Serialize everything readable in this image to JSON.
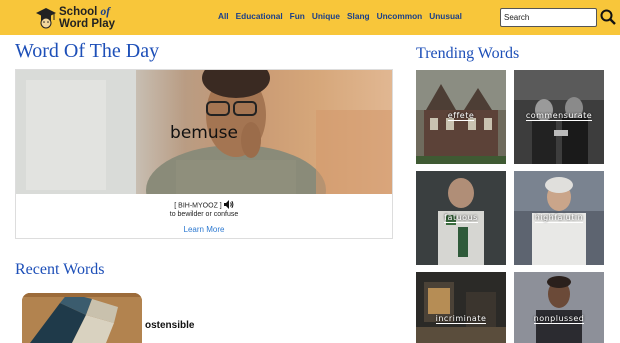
{
  "header": {
    "logo_line1": "School",
    "logo_of": "of",
    "logo_line2": "Word Play",
    "nav": [
      "All",
      "Educational",
      "Fun",
      "Unique",
      "Slang",
      "Uncommon",
      "Unusual"
    ],
    "search_placeholder": "Search"
  },
  "wotd": {
    "title": "Word Of The Day",
    "word": "bemuse",
    "pronunciation": "[ BIH-MYOOZ ]",
    "definition": "to bewilder or confuse",
    "learn_more": "Learn More"
  },
  "recent": {
    "title": "Recent Words",
    "items": [
      {
        "word": "ostensible"
      }
    ]
  },
  "trending": {
    "title": "Trending Words",
    "items": [
      {
        "word": "effete"
      },
      {
        "word": "commensurate"
      },
      {
        "word": "fatuous"
      },
      {
        "word": "highfalutin"
      },
      {
        "word": "incriminate"
      },
      {
        "word": "nonplussed"
      }
    ]
  },
  "colors": {
    "header": "#f8c63a",
    "heading": "#1d4fb8",
    "link": "#2e7ad1"
  }
}
